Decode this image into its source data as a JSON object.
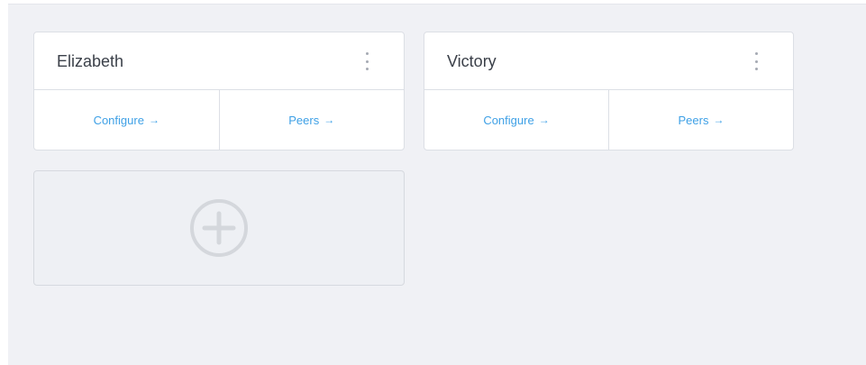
{
  "cards": [
    {
      "title": "Elizabeth",
      "configure_label": "Configure",
      "peers_label": "Peers",
      "arrow": "→"
    },
    {
      "title": "Victory",
      "configure_label": "Configure",
      "peers_label": "Peers",
      "arrow": "→"
    }
  ],
  "add_card": {
    "icon": "plus-circle-icon"
  },
  "colors": {
    "background": "#f0f1f5",
    "card": "#ffffff",
    "link": "#3ea0e6",
    "title": "#3b4049",
    "muted_icon": "#d4d7dc"
  }
}
